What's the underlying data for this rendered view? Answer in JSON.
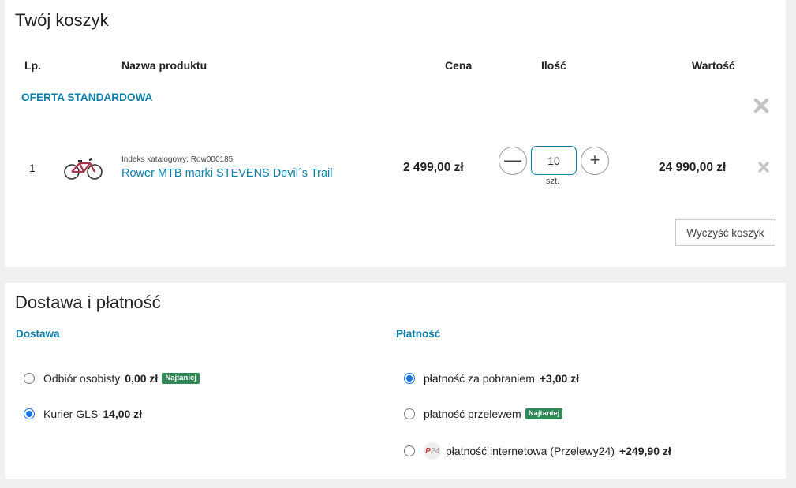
{
  "cart": {
    "title": "Twój koszyk",
    "headers": {
      "lp": "Lp.",
      "name": "Nazwa produktu",
      "price": "Cena",
      "qty": "Ilość",
      "value": "Wartość"
    },
    "offer_group": "OFERTA STANDARDOWA",
    "items": [
      {
        "lp": "1",
        "catalog_index": "Indeks katalogowy: Row000185",
        "name": "Rower MTB marki STEVENS Devil´s Trail",
        "price": "2 499,00 zł",
        "qty": "10",
        "unit": "szt.",
        "value": "24 990,00 zł"
      }
    ],
    "clear_button": "Wyczyść koszyk",
    "minus_symbol": "—",
    "plus_symbol": "+"
  },
  "shipping": {
    "title": "Dostawa i płatność",
    "delivery_heading": "Dostawa",
    "payment_heading": "Płatność",
    "delivery_options": [
      {
        "label": "Odbiór osobisty",
        "amount": "0,00 zł",
        "badge": "Najtaniej",
        "selected": false
      },
      {
        "label": "Kurier GLS",
        "amount": "14,00 zł",
        "badge": "",
        "selected": true
      }
    ],
    "payment_options": [
      {
        "label": "płatność za pobraniem",
        "amount": "+3,00 zł",
        "badge": "",
        "selected": true
      },
      {
        "label": "płatność przelewem",
        "amount": "",
        "badge": "Najtaniej",
        "selected": false
      },
      {
        "label": "płatność internetowa (Przelewy24)",
        "amount": "+249,90 zł",
        "badge": "",
        "selected": false,
        "logo_text_p": "P",
        "logo_text_24": "24"
      }
    ]
  },
  "colors": {
    "accent": "#0b7fa7",
    "badge": "#2e8b57",
    "radio_selected": "#1a73e8"
  },
  "icons": {
    "remove_group": "close-icon",
    "remove_item": "close-icon",
    "product_image": "bicycle-icon",
    "przelewy24_logo": "p24-logo"
  }
}
